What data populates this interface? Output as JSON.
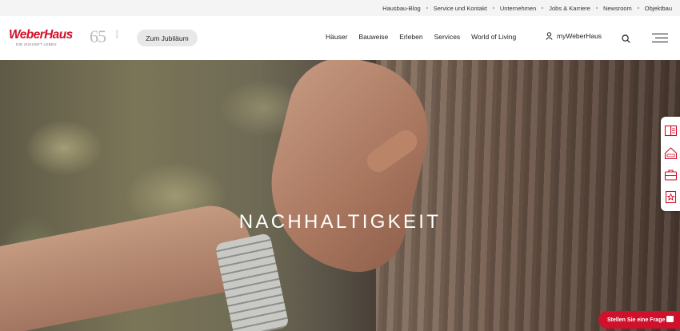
{
  "topbar": {
    "links": [
      "Hausbau-Blog",
      "Service und Kontakt",
      "Unternehmen",
      "Jobs & Karriere",
      "Newsroom",
      "Objektbau"
    ]
  },
  "header": {
    "logo_brand": "WeberHaus",
    "logo_tagline": "DIE ZUKUNFT LEBEN",
    "badge_number": "65",
    "badge_text": "JAHRE",
    "jubilee_button": "Zum Jubiläum",
    "nav": [
      "Häuser",
      "Bauweise",
      "Erleben",
      "Services",
      "World of Living"
    ],
    "account_label": "myWeberHaus"
  },
  "hero": {
    "headline": "NACHHALTIGKEIT"
  },
  "side_panel": {
    "icons": [
      "catalog-icon",
      "house-icon",
      "briefcase-icon",
      "star-icon"
    ]
  },
  "chat_button": {
    "label": "Stellen Sie eine Frage"
  },
  "colors": {
    "brand_red": "#d0112b",
    "topbar_bg": "#f4f4f4"
  }
}
